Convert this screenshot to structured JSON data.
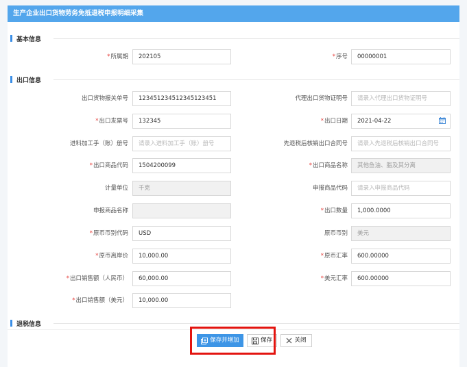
{
  "title": "生产企业出口货物劳务免抵退税申报明细采集",
  "sections": {
    "basic": "基本信息",
    "export": "出口信息",
    "refund": "退税信息"
  },
  "basic": {
    "period_label": "所属期",
    "period_value": "202105",
    "seq_label": "序号",
    "seq_value": "00000001"
  },
  "export": {
    "customs_no_label": "出口货物报关单号",
    "customs_no_value": "123451234512345123451",
    "agent_cert_label": "代理出口货物证明号",
    "agent_cert_placeholder": "请录入代理出口货物证明号",
    "invoice_no_label": "出口发票号",
    "invoice_no_value": "132345",
    "export_date_label": "出口日期",
    "export_date_value": "2021-04-22",
    "processing_manual_label": "进料加工手（账）册号",
    "processing_manual_placeholder": "请录入进料加工手（账）册号",
    "pre_refund_contract_label": "先退税后核销出口合同号",
    "pre_refund_contract_placeholder": "请录入先退税后核销出口合同号",
    "goods_code_label": "出口商品代码",
    "goods_code_value": "1504200099",
    "goods_name_label": "出口商品名称",
    "goods_name_value": "其他鱼油、脂及其分离",
    "unit_label": "计量单位",
    "unit_value": "千克",
    "declare_code_label": "申报商品代码",
    "declare_code_placeholder": "请录入申报商品代码",
    "declare_name_label": "申报商品名称",
    "declare_name_value": "",
    "quantity_label": "出口数量",
    "quantity_value": "1,000.0000",
    "currency_code_label": "原币币别代码",
    "currency_code_value": "USD",
    "currency_label": "原币币别",
    "currency_value": "美元",
    "fob_label": "原币离岸价",
    "fob_value": "10,000.00",
    "rate_label": "原币汇率",
    "rate_value": "600.00000",
    "sales_rmb_label": "出口销售额（人民币）",
    "sales_rmb_value": "60,000.00",
    "usd_rate_label": "美元汇率",
    "usd_rate_value": "600.00000",
    "sales_usd_label": "出口销售额（美元）",
    "sales_usd_value": "10,000.00"
  },
  "buttons": {
    "save_add": "保存并增加",
    "save": "保存",
    "close": "关闭"
  },
  "colors": {
    "title_bar": "#53a6ec",
    "primary": "#3d95e6",
    "required": "#e53935",
    "highlight": "#e3140f"
  }
}
